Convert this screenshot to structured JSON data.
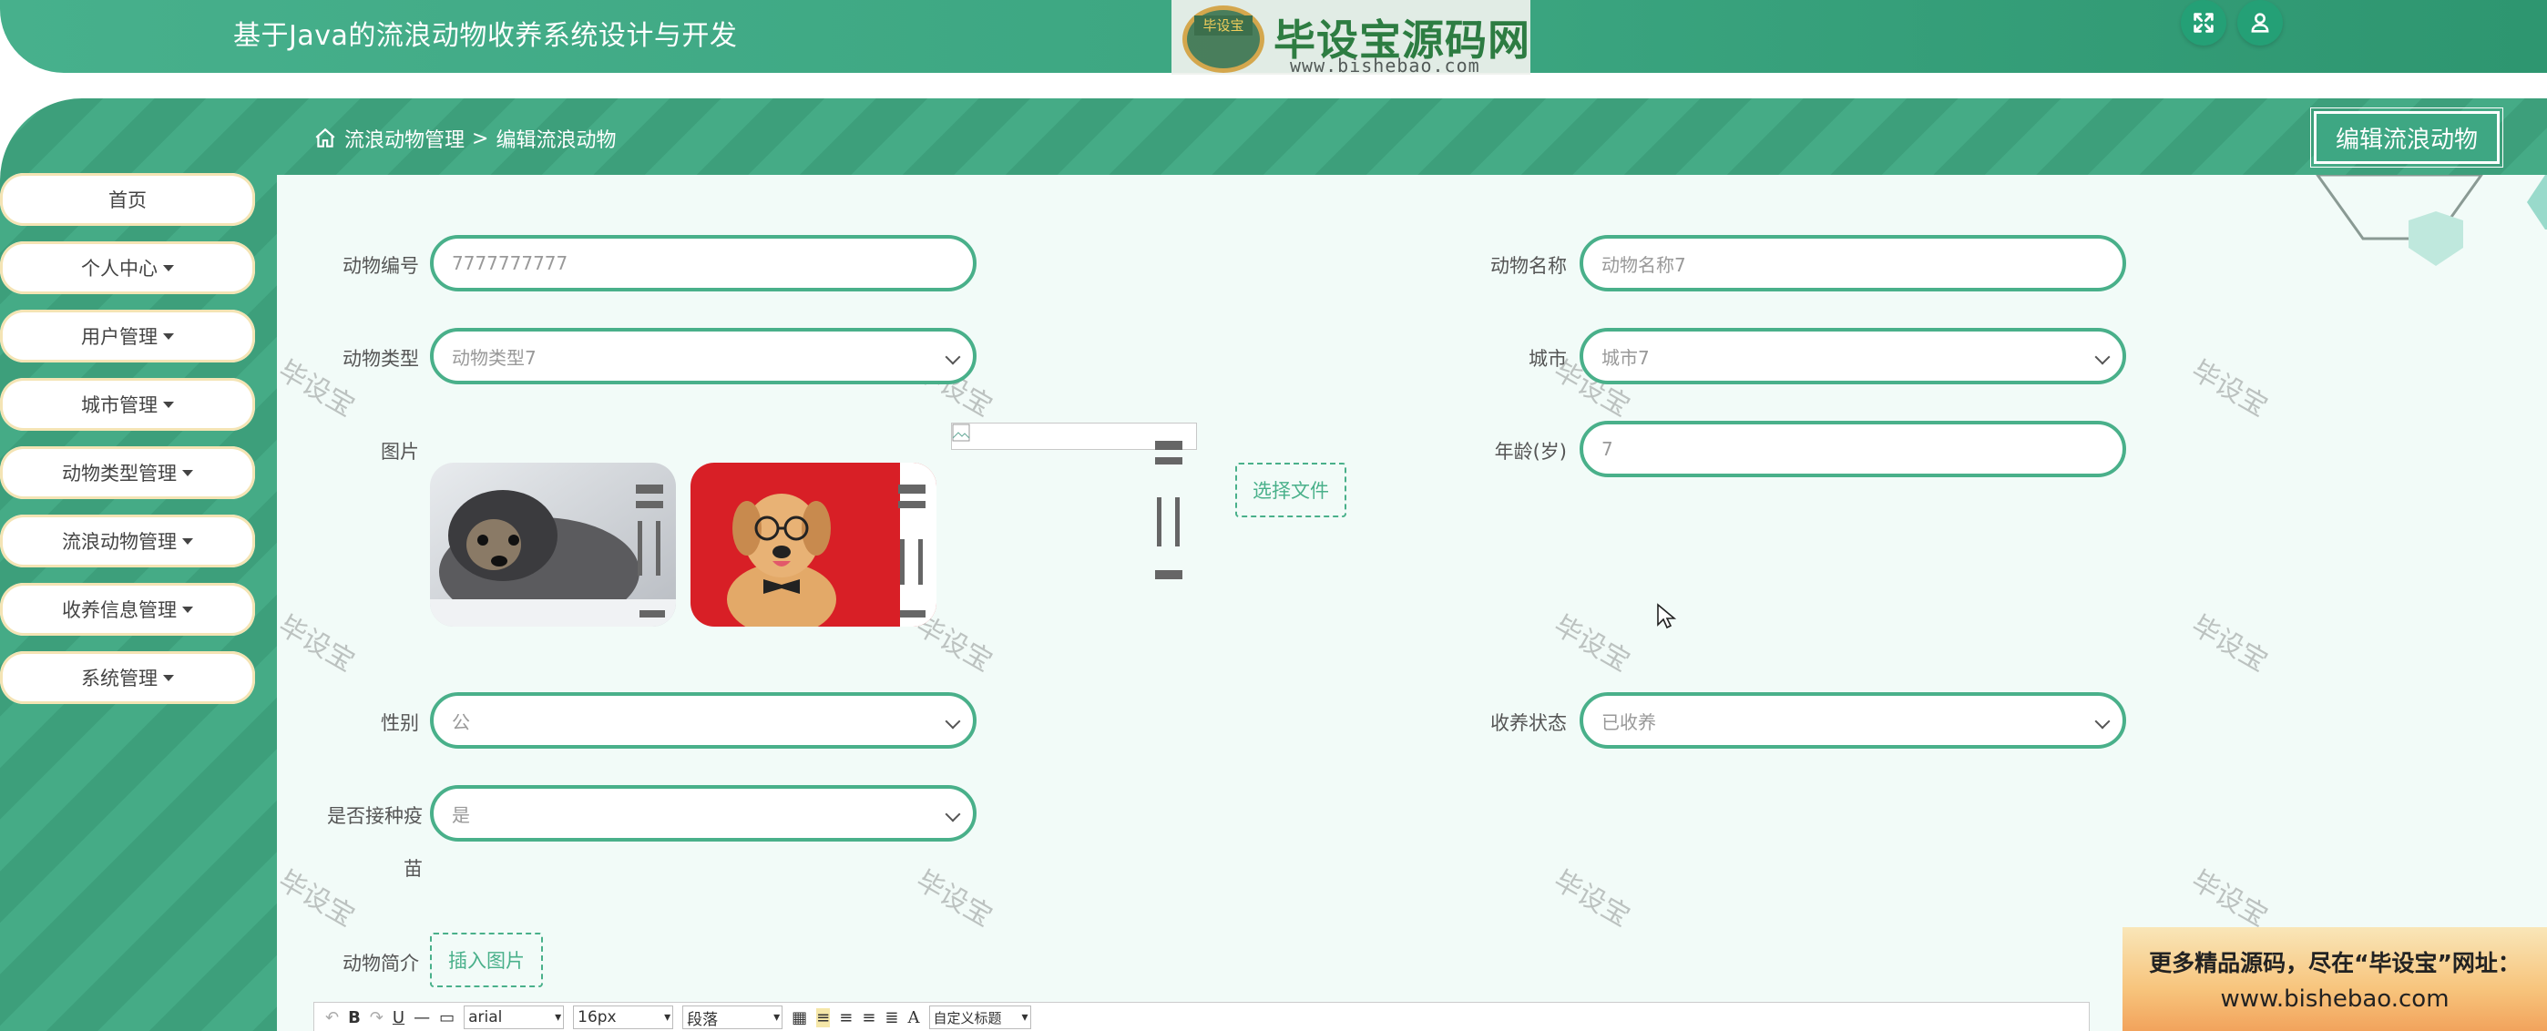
{
  "header": {
    "app_title": "基于Java的流浪动物收养系统设计与开发",
    "logo": {
      "badge": "毕设宝",
      "name": "毕设宝源码网",
      "url": "www.bishebao.com"
    },
    "icons": [
      "fullscreen-icon",
      "user-icon"
    ]
  },
  "breadcrumb": {
    "parent": "流浪动物管理",
    "separator": ">",
    "current": "编辑流浪动物"
  },
  "page_button": "编辑流浪动物",
  "sidebar": {
    "items": [
      {
        "label": "首页",
        "dropdown": false
      },
      {
        "label": "个人中心",
        "dropdown": true
      },
      {
        "label": "用户管理",
        "dropdown": true
      },
      {
        "label": "城市管理",
        "dropdown": true
      },
      {
        "label": "动物类型管理",
        "dropdown": true
      },
      {
        "label": "流浪动物管理",
        "dropdown": true
      },
      {
        "label": "收养信息管理",
        "dropdown": true
      },
      {
        "label": "系统管理",
        "dropdown": true
      }
    ]
  },
  "form": {
    "animal_no": {
      "label": "动物编号",
      "value": "7777777777"
    },
    "animal_name": {
      "label": "动物名称",
      "placeholder": "动物名称7"
    },
    "animal_type": {
      "label": "动物类型",
      "value": "动物类型7"
    },
    "city": {
      "label": "城市",
      "value": "城市7"
    },
    "image": {
      "label": "图片",
      "choose_file": "选择文件"
    },
    "age": {
      "label": "年龄(岁)",
      "value": "7"
    },
    "gender": {
      "label": "性别",
      "value": "公"
    },
    "adopt_status": {
      "label": "收养状态",
      "value": "已收养"
    },
    "vaccinated": {
      "label_line1": "是否接种疫",
      "label_line2": "苗",
      "value": "是"
    },
    "intro": {
      "label": "动物简介",
      "insert_image": "插入图片"
    }
  },
  "editor_toolbar": {
    "font": "arial",
    "size": "16px",
    "paragraph": "段落",
    "custom_title": "自定义标题",
    "buttons": [
      "B",
      "U",
      "A"
    ]
  },
  "watermark": "毕设宝",
  "promo": {
    "line1": "更多精品源码，尽在“毕设宝”网址：",
    "line2": "www.bishebao.com"
  },
  "colors": {
    "primary": "#49b08a",
    "header": "#3aa47f",
    "panel": "#f2fbf8",
    "sidebar_border": "#f4e4b4"
  }
}
